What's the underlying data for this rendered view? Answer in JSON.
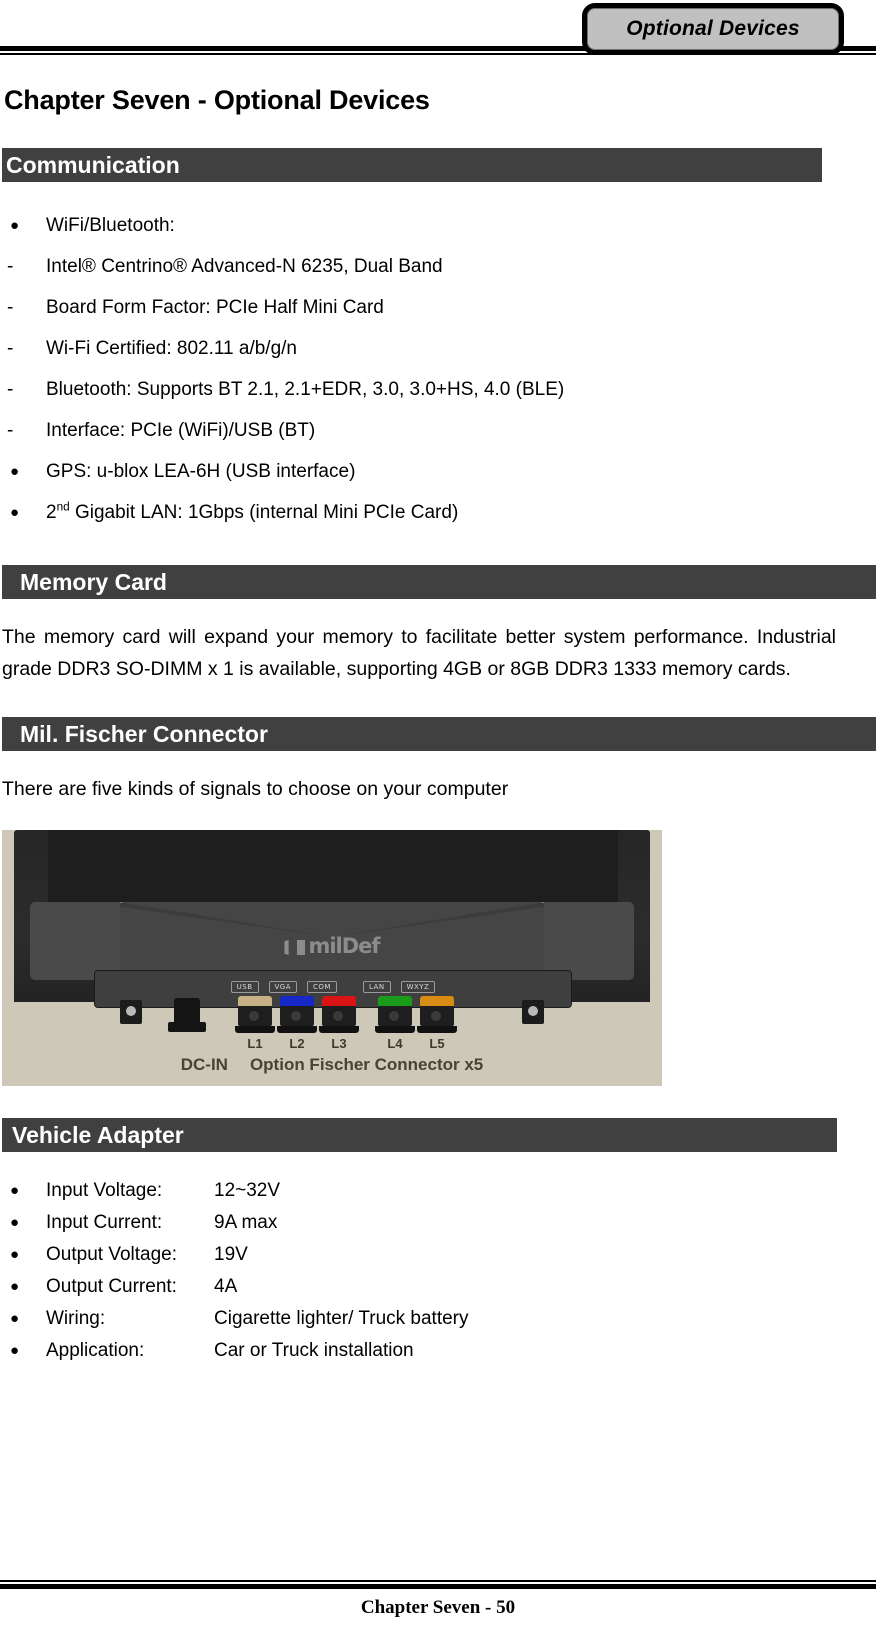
{
  "header": {
    "tab_label": "Optional Devices"
  },
  "chapter_title": "Chapter Seven - Optional Devices",
  "sections": {
    "communication": {
      "heading": "Communication",
      "items": [
        {
          "marker": "bullet",
          "text": "WiFi/Bluetooth:"
        },
        {
          "marker": "dash",
          "text": "Intel® Centrino® Advanced-N 6235, Dual Band"
        },
        {
          "marker": "dash",
          "text": "Board Form Factor: PCIe Half Mini Card"
        },
        {
          "marker": "dash",
          "text": "Wi-Fi Certified: 802.11 a/b/g/n"
        },
        {
          "marker": "dash",
          "text": "Bluetooth: Supports BT 2.1, 2.1+EDR, 3.0, 3.0+HS, 4.0 (BLE)"
        },
        {
          "marker": "dash",
          "text": "Interface: PCIe (WiFi)/USB (BT)"
        },
        {
          "marker": "bullet",
          "text": "GPS: u-blox LEA-6H (USB interface)"
        },
        {
          "marker": "bullet",
          "text": "2",
          "sup": "nd",
          "text_after": " Gigabit LAN: 1Gbps (internal Mini PCIe Card)"
        }
      ]
    },
    "memory_card": {
      "heading": "Memory Card",
      "paragraph": "The memory card will expand your memory to facilitate better system performance. Industrial grade DDR3 SO-DIMM x 1 is available, supporting 4GB or 8GB DDR3 1333 memory cards."
    },
    "fischer": {
      "heading": "Mil. Fischer Connector",
      "paragraph": "There are five kinds of signals to choose on your computer",
      "figure": {
        "brand": "milDef",
        "port_labels": [
          "USB",
          "VGA",
          "COM",
          "LAN",
          "WXYZ"
        ],
        "connectors": [
          {
            "label": "L1",
            "color": "#c8b184"
          },
          {
            "label": "L2",
            "color": "#1628c8"
          },
          {
            "label": "L3",
            "color": "#d81414"
          },
          {
            "label": "L4",
            "color": "#1a9c1a"
          },
          {
            "label": "L5",
            "color": "#d98c14"
          }
        ],
        "caption_dcin": "DC-IN",
        "caption_main": "Option Fischer Connector x5"
      }
    },
    "vehicle_adapter": {
      "heading": "Vehicle Adapter",
      "items": [
        {
          "label": "Input Voltage:",
          "value": "12~32V"
        },
        {
          "label": "Input Current:",
          "value": "9A max"
        },
        {
          "label": "Output Voltage:",
          "value": "19V"
        },
        {
          "label": "Output Current:",
          "value": "4A"
        },
        {
          "label": "Wiring:",
          "value": "Cigarette lighter/ Truck battery"
        },
        {
          "label": "Application:",
          "value": "Car or Truck installation"
        }
      ]
    }
  },
  "footer": {
    "text": "Chapter Seven - 50"
  },
  "colors": {
    "section_bar": "#404040",
    "rule": "#000000",
    "tab_fill": "#c0c0c0"
  }
}
